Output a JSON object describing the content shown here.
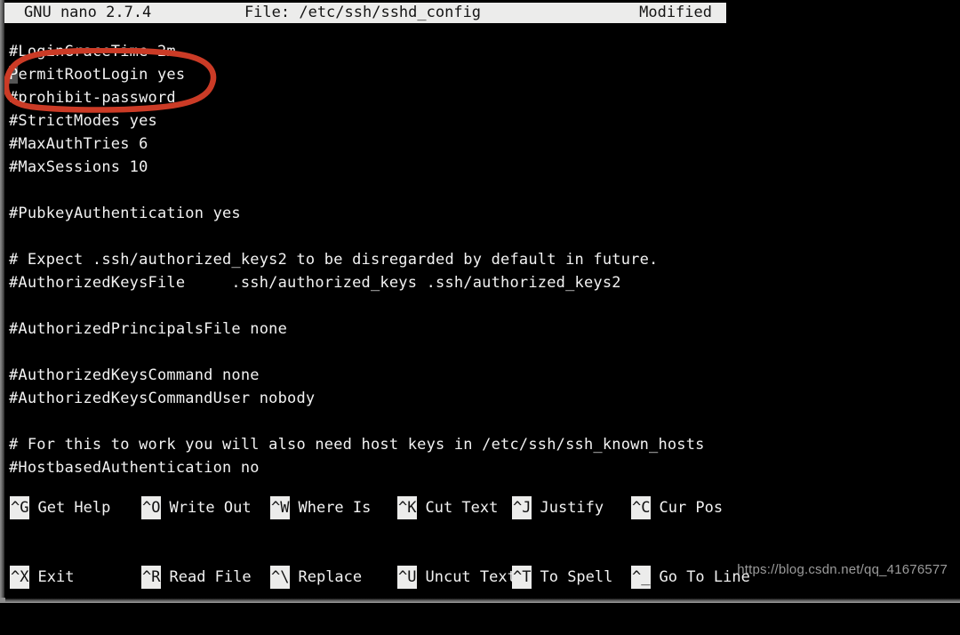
{
  "titlebar": {
    "app": "GNU nano 2.7.4",
    "file": "File: /etc/ssh/sshd_config",
    "state": "Modified"
  },
  "editor": {
    "cursor_char": "P",
    "lines": [
      {
        "text": "#LoginGraceTime 2m"
      },
      {
        "text": "PermitRootLogin yes",
        "cursor": true
      },
      {
        "text": "#prohibit-password"
      },
      {
        "text": "#StrictModes yes"
      },
      {
        "text": "#MaxAuthTries 6"
      },
      {
        "text": "#MaxSessions 10"
      },
      {
        "text": ""
      },
      {
        "text": "#PubkeyAuthentication yes"
      },
      {
        "text": ""
      },
      {
        "text": "# Expect .ssh/authorized_keys2 to be disregarded by default in future."
      },
      {
        "text": "#AuthorizedKeysFile     .ssh/authorized_keys .ssh/authorized_keys2"
      },
      {
        "text": ""
      },
      {
        "text": "#AuthorizedPrincipalsFile none"
      },
      {
        "text": ""
      },
      {
        "text": "#AuthorizedKeysCommand none"
      },
      {
        "text": "#AuthorizedKeysCommandUser nobody"
      },
      {
        "text": ""
      },
      {
        "text": "# For this to work you will also need host keys in /etc/ssh/ssh_known_hosts"
      },
      {
        "text": "#HostbasedAuthentication no"
      }
    ]
  },
  "annotation": {
    "shape": "hand-drawn-ellipse",
    "color": "#cb3b26",
    "targets": "PermitRootLogin yes / #prohibit-password"
  },
  "shortcuts": {
    "row1": [
      {
        "key": "^G",
        "label": "Get Help"
      },
      {
        "key": "^O",
        "label": "Write Out"
      },
      {
        "key": "^W",
        "label": "Where Is"
      },
      {
        "key": "^K",
        "label": "Cut Text"
      },
      {
        "key": "^J",
        "label": "Justify"
      },
      {
        "key": "^C",
        "label": "Cur Pos"
      }
    ],
    "row2": [
      {
        "key": "^X",
        "label": "Exit"
      },
      {
        "key": "^R",
        "label": "Read File"
      },
      {
        "key": "^\\",
        "label": "Replace"
      },
      {
        "key": "^U",
        "label": "Uncut Text"
      },
      {
        "key": "^T",
        "label": "To Spell"
      },
      {
        "key": "^_",
        "label": "Go To Line"
      }
    ]
  },
  "watermark": {
    "text": "https://blog.csdn.net/qq_41676577"
  },
  "colors": {
    "background": "#000000",
    "foreground": "#f2f2f2",
    "reverse_bg": "#ececeb",
    "reverse_fg": "#141414",
    "annotation_red": "#cb3b26",
    "cursor_block": "#565656"
  }
}
